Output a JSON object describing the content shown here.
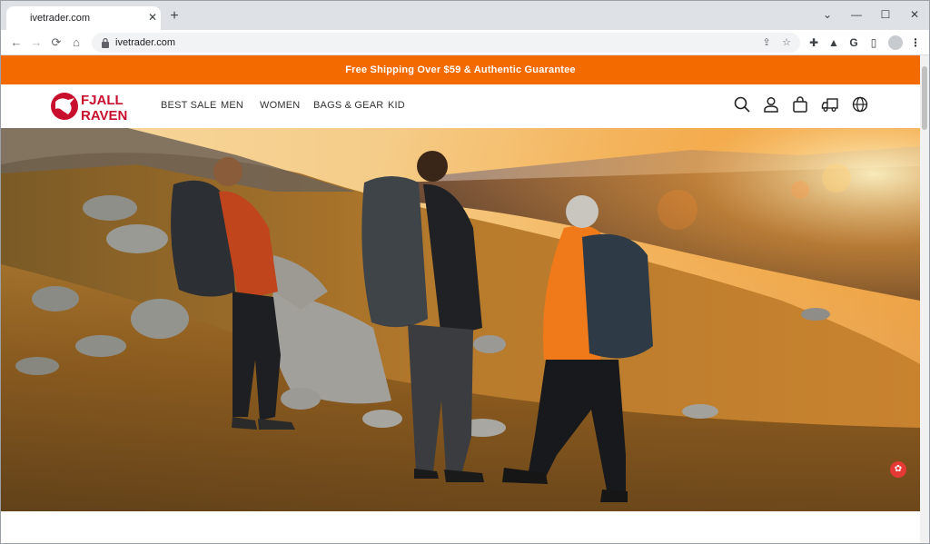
{
  "browser": {
    "tab_title": "ivetrader.com",
    "tab_close": "✕",
    "new_tab": "+",
    "url": "ivetrader.com",
    "window_controls": {
      "minimize": "—",
      "maximize": "☐",
      "close": "✕",
      "tab_search": "⌄"
    },
    "nav": {
      "back": "←",
      "forward": "→",
      "reload": "⟳",
      "home": "⌂"
    },
    "omnibox_icons": {
      "share": "⇪",
      "bookmark": "☆"
    },
    "extensions": {
      "puzzle": "✚",
      "lab": "▲",
      "google": "G",
      "sidepanel": "▯",
      "menu": "⋮"
    }
  },
  "site": {
    "announcement": "Free Shipping Over $59 & Authentic Guarantee",
    "logo": {
      "line1": "FJALL",
      "line2": "RAVEN",
      "color": "#c8102e"
    },
    "nav": [
      "BEST SALE",
      "MEN",
      "WOMEN",
      "BAGS & GEAR",
      "KID"
    ],
    "header_icons": [
      "search-icon",
      "account-icon",
      "cart-icon",
      "shipping-truck-icon",
      "globe-icon"
    ],
    "accent_color": "#f26a00",
    "help_badge": "✿"
  }
}
